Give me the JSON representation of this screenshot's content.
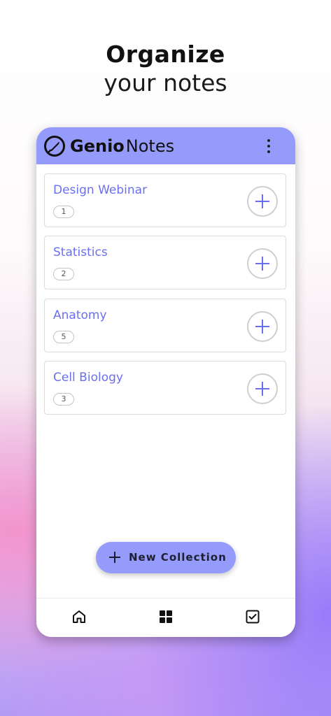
{
  "headline": {
    "line1": "Organize",
    "line2": "your notes"
  },
  "app": {
    "brand_bold": "Genio",
    "brand_light": "Notes",
    "accent_color": "#959bfb",
    "title_color": "#6a6ff0"
  },
  "collections": [
    {
      "title": "Design Webinar",
      "count": "1"
    },
    {
      "title": "Statistics",
      "count": "2"
    },
    {
      "title": "Anatomy",
      "count": "5"
    },
    {
      "title": "Cell Biology",
      "count": "3"
    }
  ],
  "actions": {
    "new_collection_label": "New Collection"
  },
  "bottom_nav": {
    "items": [
      "home-icon",
      "grid-icon",
      "checkbox-icon"
    ]
  },
  "icons": {
    "logo": "genio-logo-icon",
    "menu": "more-vertical-icon",
    "add": "plus-icon"
  }
}
